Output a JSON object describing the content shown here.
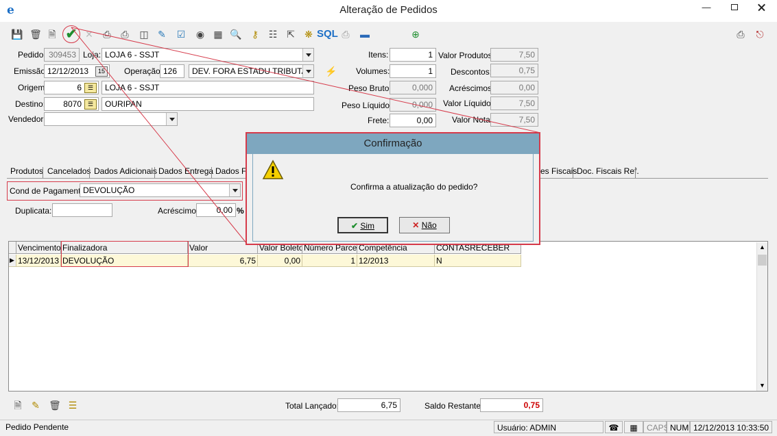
{
  "window": {
    "title": "Alteração de Pedidos",
    "app_icon": "e"
  },
  "toolbar": {
    "icons": [
      "save-icon",
      "delete-icon",
      "new-icon",
      "confirm-icon",
      "cancel-icon",
      "print-icon",
      "print-options-icon",
      "stack-icon",
      "report-icon",
      "checklist-icon",
      "binoculars-icon",
      "grid-icon",
      "preview-icon",
      "key-icon",
      "book-icon",
      "export-icon",
      "modules-icon",
      "sql-icon",
      "printer-icon",
      "barcode-icon",
      "target-icon"
    ],
    "sql_label": "SQL"
  },
  "header": {
    "pedido_label": "Pedido:",
    "pedido_value": "309453",
    "loja_label": "Loja:",
    "loja_value": "LOJA 6 - SSJT",
    "emissao_label": "Emissão:",
    "emissao_value": "12/12/2013",
    "calendar_label": "15",
    "operacao_label": "Operação:",
    "operacao_code": "126",
    "operacao_value": "DEV. FORA ESTADU TRIBUTAD",
    "origem_label": "Origem:",
    "origem_code": "6",
    "origem_value": "LOJA 6 - SSJT",
    "destino_label": "Destino:",
    "destino_code": "8070",
    "destino_value": "OURIPAN",
    "vendedor_label": "Vendedor:",
    "vendedor_value": ""
  },
  "totals": {
    "itens_label": "Itens:",
    "itens_value": "1",
    "volumes_label": "Volumes:",
    "volumes_value": "1",
    "peso_bruto_label": "Peso Bruto:",
    "peso_bruto_value": "0,000",
    "peso_liquido_label": "Peso Líquido:",
    "peso_liquido_value": "0,000",
    "frete_label": "Frete:",
    "frete_value": "0,00",
    "valor_produtos_label": "Valor Produtos:",
    "valor_produtos_value": "7,50",
    "descontos_label": "Descontos:",
    "descontos_value": "0,75",
    "acrescimos_label": "Acréscimos:",
    "acrescimos_value": "0,00",
    "valor_liquido_label": "Valor Líquido:",
    "valor_liquido_value": "7,50",
    "valor_nota_label": "Valor Nota:",
    "valor_nota_value": "7,50"
  },
  "tabs": [
    "Produtos",
    "Cancelados",
    "Dados Adicionais",
    "Dados Entrega",
    "Dados Fi",
    "es Fiscais",
    "Doc. Fiscais Ref."
  ],
  "payment": {
    "cond_label": "Cond de Pagamento:",
    "cond_value": "DEVOLUÇÃO",
    "duplicata_label": "Duplicata:",
    "duplicata_value": "",
    "acrescimo_label": "Acréscimo:",
    "acrescimo_value": "0,00",
    "percent": "%"
  },
  "grid": {
    "columns": [
      "Vencimento",
      "Finalizadora",
      "Valor",
      "Valor Boleto",
      "Número Parcela",
      "Competência",
      "CONTASRECEBER"
    ],
    "rows": [
      {
        "vencimento": "13/12/2013",
        "finalizadora": "DEVOLUÇÃO",
        "valor": "6,75",
        "valor_boleto": "0,00",
        "numero_parcela": "1",
        "competencia": "12/2013",
        "contasreceber": "N"
      }
    ]
  },
  "footer": {
    "total_lancado_label": "Total Lançado:",
    "total_lancado_value": "6,75",
    "saldo_restante_label": "Saldo Restante:",
    "saldo_restante_value": "0,75"
  },
  "dialog": {
    "title": "Confirmação",
    "message": "Confirma a atualização do pedido?",
    "yes_label": "Sim",
    "no_label": "Não"
  },
  "statusbar": {
    "status": "Pedido Pendente",
    "user": "Usuário: ADMIN",
    "caps": "CAPS",
    "num": "NUM",
    "datetime": "12/12/2013 10:33:50"
  },
  "colors": {
    "annotation": "#d63a4a",
    "dialog_title": "#7ea7bf",
    "saldo": "#cc0000"
  }
}
